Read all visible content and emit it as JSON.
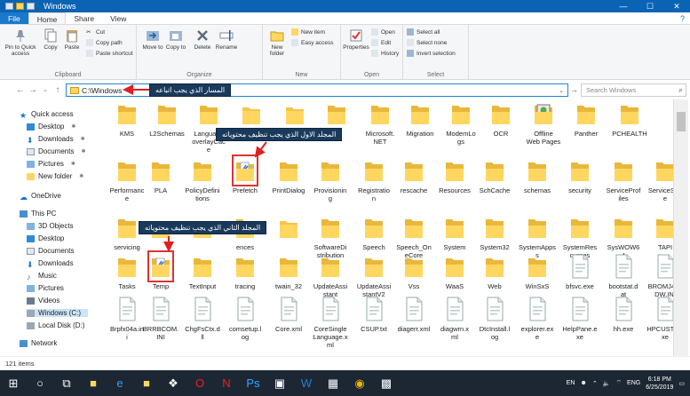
{
  "window": {
    "title": "Windows"
  },
  "tabs": [
    "File",
    "Home",
    "Share",
    "View"
  ],
  "ribbon": {
    "clipboard": {
      "label": "Clipboard",
      "pin": "Pin to Quick access",
      "copy": "Copy",
      "paste": "Paste",
      "cut": "Cut",
      "copy_path": "Copy path",
      "paste_shortcut": "Paste shortcut"
    },
    "organize": {
      "label": "Organize",
      "move_to": "Move to",
      "copy_to": "Copy to",
      "delete": "Delete",
      "rename": "Rename"
    },
    "new": {
      "label": "New",
      "new_folder": "New folder",
      "new_item": "New item",
      "easy_access": "Easy access"
    },
    "open": {
      "label": "Open",
      "properties": "Properties",
      "open": "Open",
      "edit": "Edit",
      "history": "History"
    },
    "select": {
      "label": "Select",
      "select_all": "Select all",
      "select_none": "Select none",
      "invert": "Invert selection"
    }
  },
  "address": {
    "path": "C:\\Windows",
    "search_placeholder": "Search Windows"
  },
  "callouts": {
    "path": "المسار الذي يجب اتباعه",
    "first": "المجلد الاول الذي يجب تنظيف محتوياته",
    "second": "المجلد الثاني الذي يجب تنظيف محتوياته"
  },
  "nav": {
    "quick_access": "Quick access",
    "desktop": "Desktop",
    "downloads": "Downloads",
    "documents": "Documents",
    "pictures": "Pictures",
    "new_folder": "New folder",
    "onedrive": "OneDrive",
    "this_pc": "This PC",
    "objects3d": "3D Objects",
    "pc_desktop": "Desktop",
    "pc_documents": "Documents",
    "pc_downloads": "Downloads",
    "music": "Music",
    "pc_pictures": "Pictures",
    "videos": "Videos",
    "local_c": "Windows (C:)",
    "local_d": "Local Disk (D:)",
    "network": "Network"
  },
  "rows": [
    [
      "KMS",
      "L2Schemas",
      "Language\noverlayCac\ne",
      "",
      "",
      "dia",
      "Microsoft.\nNET",
      "Migration",
      "ModemLo\ngs",
      "OCR",
      "Offline\nWeb Pages",
      "Panther",
      "PCHEALTH"
    ],
    [
      "Performanc\ne",
      "PLA",
      "PolicyDefini\ntions",
      "Prefetch",
      "PrintDialog",
      "Provisionin\ng",
      "Registratio\nn",
      "rescache",
      "Resources",
      "SchCache",
      "schemas",
      "security",
      "ServiceProf\niles",
      "ServiceStat\ne"
    ],
    [
      "servicing",
      "",
      "",
      "ences",
      "",
      "SoftwareDi\nstribution",
      "Speech",
      "Speech_On\neCore",
      "System",
      "System32",
      "SystemApps\ns",
      "SystemRes\nources",
      "SysWOW6\n4",
      "TAPI"
    ],
    [
      "Tasks",
      "Temp",
      "TextInput",
      "tracing",
      "twain_32",
      "UpdateAssi\nstant",
      "UpdateAssi\nstantV2",
      "Vss",
      "WaaS",
      "Web",
      "WinSxS",
      "bfsvc.exe",
      "bootstat.d\nat",
      "BROMJ480\nDW.INI"
    ],
    [
      "Brpfx04a.in\ni",
      "BRRBCOM.\nINI",
      "ChgFsCtx.d\nll",
      "comsetup.l\nog",
      "Core.xml",
      "CoreSingle\nLanguage.x\nml",
      "CSUP.txt",
      "diagerr.xml",
      "diagwrn.x\nml",
      "DtcInstall.l\nog",
      "explorer.ex\ne",
      "HelpPane.e\nxe",
      "hh.exe",
      "HPCUST1.e\nxe"
    ]
  ],
  "status": {
    "items": "121 items"
  },
  "taskbar": {
    "lang": "ENG",
    "time": "6:18 PM",
    "date": "6/25/2019",
    "en": "EN"
  },
  "colors": {
    "title_bar": "#0b63b4",
    "callout_bg": "#1a3a5c",
    "arrow": "#e02020",
    "folder": "#ffd760"
  }
}
